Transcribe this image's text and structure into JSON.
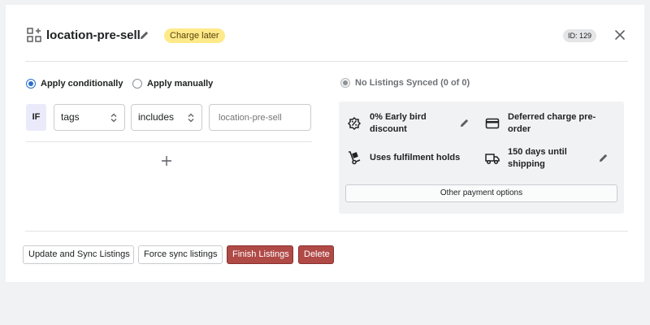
{
  "header": {
    "title": "location-pre-sell",
    "badge": "Charge later",
    "id_label": "ID: 129",
    "icons": {
      "app": "apps-add-icon",
      "edit": "pencil-icon",
      "close": "close-icon"
    },
    "badge_color": "#ffea8a"
  },
  "rules": {
    "apply_conditionally": "Apply conditionally",
    "apply_manually": "Apply manually",
    "selected_mode": "Apply conditionally",
    "condition": {
      "if_label": "IF",
      "field": "tags",
      "operator": "includes",
      "value_placeholder": "location-pre-sell"
    }
  },
  "sync": {
    "status": "No Listings Synced (0 of 0)"
  },
  "features": {
    "early_bird": "0% Early bird discount",
    "deferred": "Deferred charge pre-order",
    "fulfilment": "Uses fulfilment holds",
    "shipping": "150 days until shipping",
    "other_options": "Other payment options",
    "icons": [
      "discount-icon",
      "credit-card-icon",
      "hand-truck-icon",
      "shipping-truck-icon"
    ]
  },
  "actions": {
    "update_sync": "Update and Sync Listings",
    "force_sync": "Force sync listings",
    "finish": "Finish Listings",
    "delete": "Delete",
    "danger_color": "#b04a47"
  }
}
